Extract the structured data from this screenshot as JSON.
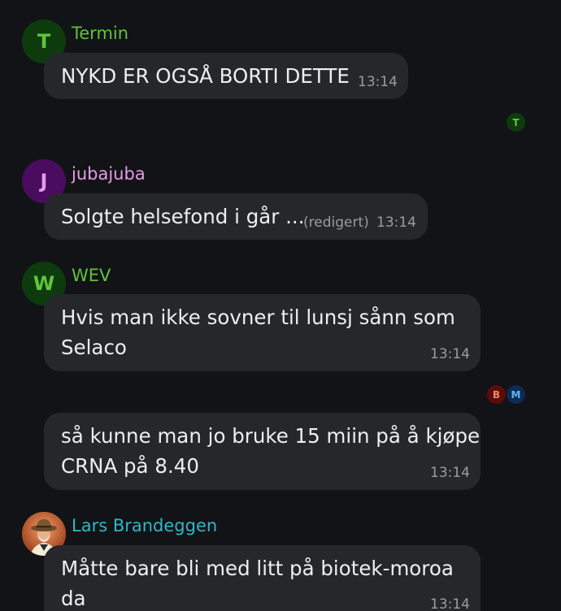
{
  "messages": [
    {
      "author": "Termin",
      "author_color": "#5fc43a",
      "avatar_letter": "T",
      "text": "NYKD ER OGSÅ BORTI DETTE",
      "time": "13:14"
    },
    {
      "author": "jubajuba",
      "author_color": "#e59be8",
      "avatar_letter": "J",
      "text": "Solgte helsefond i går ...",
      "edited_label": "(redigert)",
      "time": "13:14"
    },
    {
      "author": "WEV",
      "author_color": "#5fc43a",
      "avatar_letter": "W",
      "text_lines": [
        "Hvis man ikke sovner til lunsj sånn som",
        "Selaco"
      ],
      "time": "13:14"
    },
    {
      "text_lines": [
        "så kunne man jo bruke 15 miin på å kjøpe",
        "CRNA på 8.40"
      ],
      "time": "13:14"
    },
    {
      "author": "Lars Brandeggen",
      "author_color": "#2fb8c8",
      "avatar_icon": "cowboy-portrait-icon",
      "text_lines": [
        "Måtte bare bli med litt på biotek-moroa",
        "da"
      ],
      "time": "13:14"
    }
  ],
  "read_receipts": [
    {
      "letter": "T"
    },
    {
      "letter": "B"
    },
    {
      "letter": "M"
    }
  ]
}
